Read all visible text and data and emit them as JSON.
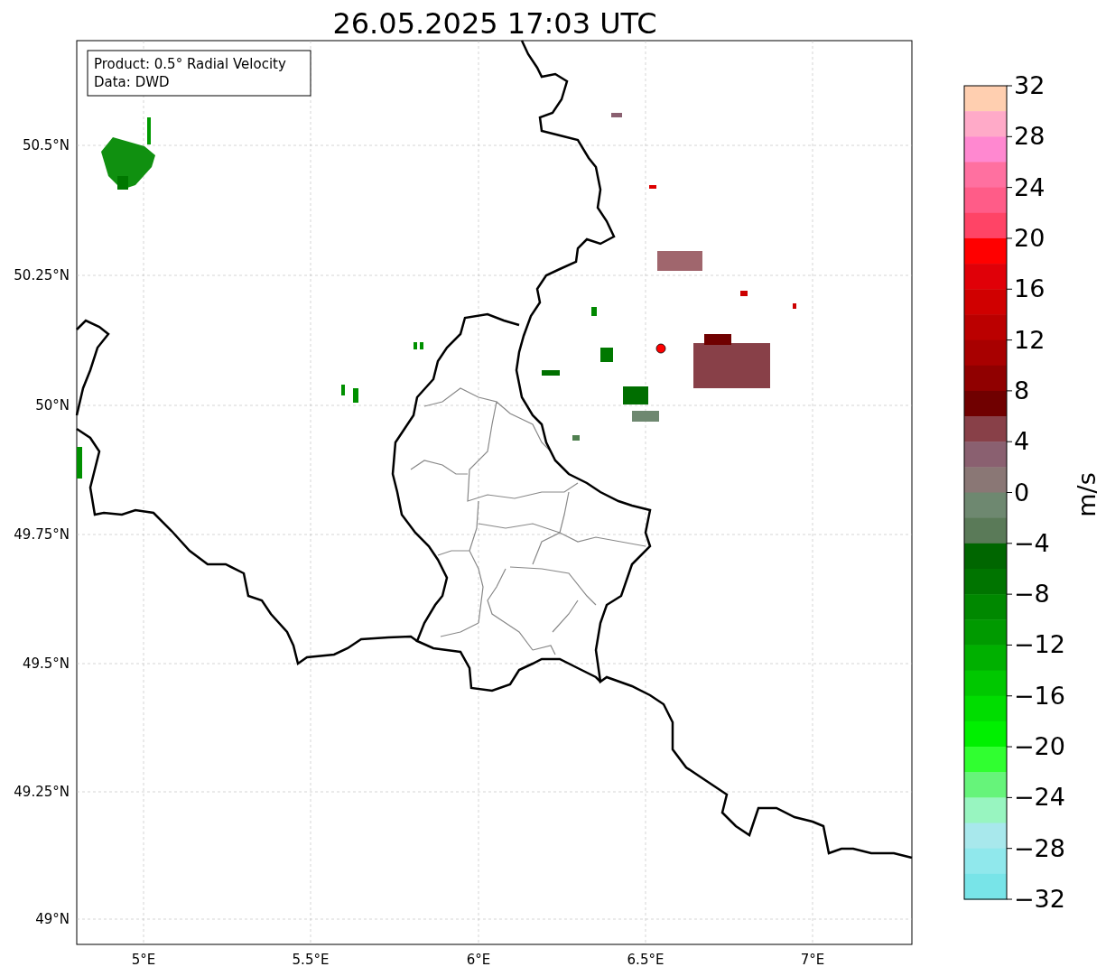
{
  "title": "26.05.2025 17:03 UTC",
  "info_box": [
    "Product: 0.5° Radial Velocity",
    "Data: DWD"
  ],
  "map": {
    "lon_ticks": [
      "5°E",
      "5.5°E",
      "6°E",
      "6.5°E",
      "7°E"
    ],
    "lat_ticks": [
      "50.5°N",
      "50.25°N",
      "50°N",
      "49.75°N",
      "49.5°N",
      "49.25°N",
      "49°N"
    ]
  },
  "colorbar": {
    "label": "m/s",
    "ticks": [
      "32",
      "28",
      "24",
      "20",
      "16",
      "12",
      "8",
      "4",
      "0",
      "−4",
      "−8",
      "−12",
      "−16",
      "−20",
      "−24",
      "−28",
      "−32"
    ],
    "bands": [
      {
        "color": "#ffcfb0"
      },
      {
        "color": "#ffaac8"
      },
      {
        "color": "#ff88d0"
      },
      {
        "color": "#ff70a0"
      },
      {
        "color": "#ff5c88"
      },
      {
        "color": "#ff4466"
      },
      {
        "color": "#ff0000"
      },
      {
        "color": "#e00008"
      },
      {
        "color": "#d00000"
      },
      {
        "color": "#bb0000"
      },
      {
        "color": "#a80000"
      },
      {
        "color": "#900000"
      },
      {
        "color": "#700000"
      },
      {
        "color": "#884048"
      },
      {
        "color": "#8a6070"
      },
      {
        "color": "#8a7775"
      },
      {
        "color": "#6e8870"
      },
      {
        "color": "#5a7a58"
      },
      {
        "color": "#006600"
      },
      {
        "color": "#007400"
      },
      {
        "color": "#008800"
      },
      {
        "color": "#009a00"
      },
      {
        "color": "#00b000"
      },
      {
        "color": "#00c800"
      },
      {
        "color": "#00dd00"
      },
      {
        "color": "#00f000"
      },
      {
        "color": "#30ff30"
      },
      {
        "color": "#66f47a"
      },
      {
        "color": "#98f5c0"
      },
      {
        "color": "#a8e8ec"
      },
      {
        "color": "#90e8ec"
      },
      {
        "color": "#78e4e8"
      }
    ]
  }
}
